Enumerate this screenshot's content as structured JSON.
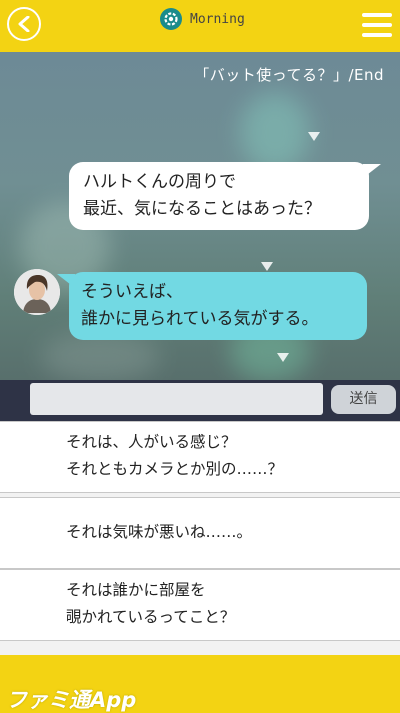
{
  "header": {
    "title": "Morning",
    "back_icon": "chevron-left-icon",
    "time_icon": "gear-icon",
    "menu_icon": "hamburger-menu-icon",
    "colors": {
      "bar": "#f3d313",
      "icon_bg": "#1a8b8b"
    }
  },
  "chat": {
    "chapter_label": "「バット使ってる？」/End",
    "messages": [
      {
        "side": "right",
        "line1": "ハルトくんの周りで",
        "line2": "最近、気になることはあった？"
      },
      {
        "side": "left",
        "line1": "そういえば、",
        "line2": "誰かに見られている気がする。"
      }
    ],
    "colors": {
      "outgoing": "#ffffff",
      "incoming": "#72d9e3"
    }
  },
  "composer": {
    "input_value": "",
    "send_label": "送信"
  },
  "options": [
    {
      "line1": "それは、人がいる感じ？",
      "line2": "それともカメラとか別の……？"
    },
    {
      "line1": "それは気味が悪いね……。",
      "line2": ""
    },
    {
      "line1": "それは誰かに部屋を",
      "line2": "覗かれているってこと？"
    }
  ],
  "footer": {
    "logo_text": "ファミ通App"
  }
}
